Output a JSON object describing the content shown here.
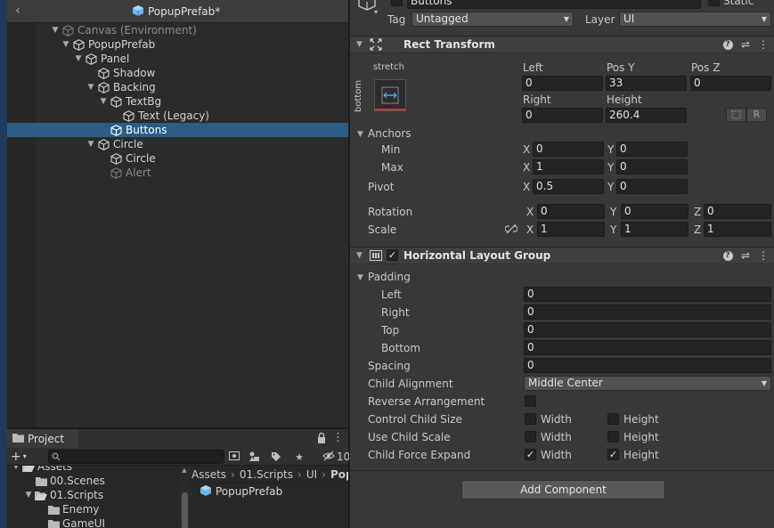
{
  "colors": {
    "selection": "#2c5d87",
    "prefab_cube": "#6fb6e8",
    "inspector_bg": "#383838",
    "hierarchy_bg": "#2b2b2b"
  },
  "hierarchy": {
    "title": "PopupPrefab*",
    "rows": [
      {
        "label": "Canvas (Environment)",
        "expanded": true,
        "state": "dim"
      },
      {
        "label": "PopupPrefab",
        "expanded": true,
        "state": "normal"
      },
      {
        "label": "Panel",
        "expanded": true,
        "state": "normal"
      },
      {
        "label": "Shadow",
        "expanded": null,
        "state": "normal"
      },
      {
        "label": "Backing",
        "expanded": true,
        "state": "normal"
      },
      {
        "label": "TextBg",
        "expanded": true,
        "state": "normal"
      },
      {
        "label": "Text (Legacy)",
        "expanded": null,
        "state": "normal"
      },
      {
        "label": "Buttons",
        "expanded": null,
        "state": "selected"
      },
      {
        "label": "Circle",
        "expanded": true,
        "state": "normal"
      },
      {
        "label": "Circle",
        "expanded": null,
        "state": "normal"
      },
      {
        "label": "Alert",
        "expanded": null,
        "state": "dim"
      }
    ]
  },
  "project": {
    "tab_label": "Project",
    "search_placeholder": "",
    "hidden_count": "10",
    "tree": [
      {
        "label": "Assets",
        "expanded": true
      },
      {
        "label": "00.Scenes",
        "expanded": null
      },
      {
        "label": "01.Scripts",
        "expanded": true
      },
      {
        "label": "Enemy",
        "expanded": null
      },
      {
        "label": "GameUI",
        "expanded": null
      }
    ],
    "breadcrumb": [
      "Assets",
      "01.Scripts",
      "UI",
      "Pop"
    ],
    "files": [
      "PopupPrefab"
    ]
  },
  "inspector": {
    "gameobject_name": "Buttons",
    "static_label": "Static",
    "tag_label": "Tag",
    "tag_value": "Untagged",
    "layer_label": "Layer",
    "layer_value": "UI",
    "rect_transform": {
      "title": "Rect Transform",
      "anchor_preset_h": "stretch",
      "anchor_preset_v": "bottom",
      "left_label": "Left",
      "left": "0",
      "posy_label": "Pos Y",
      "posy": "33",
      "posz_label": "Pos Z",
      "posz": "0",
      "right_label": "Right",
      "right": "0",
      "height_label": "Height",
      "height": "260.4",
      "raw_label": "R",
      "anchors_label": "Anchors",
      "min_label": "Min",
      "min_x": "0",
      "min_y": "0",
      "max_label": "Max",
      "max_x": "1",
      "max_y": "0",
      "pivot_label": "Pivot",
      "pivot_x": "0.5",
      "pivot_y": "0",
      "rotation_label": "Rotation",
      "rot_x": "0",
      "rot_y": "0",
      "rot_z": "0",
      "scale_label": "Scale",
      "scale_x": "1",
      "scale_y": "1",
      "scale_z": "1",
      "x": "X",
      "y": "Y",
      "z": "Z"
    },
    "hlg": {
      "title": "Horizontal Layout Group",
      "enabled": true,
      "padding_label": "Padding",
      "left_label": "Left",
      "left": "0",
      "right_label": "Right",
      "right": "0",
      "top_label": "Top",
      "top": "0",
      "bottom_label": "Bottom",
      "bottom": "0",
      "spacing_label": "Spacing",
      "spacing": "0",
      "child_alignment_label": "Child Alignment",
      "child_alignment": "Middle Center",
      "reverse_label": "Reverse Arrangement",
      "reverse": false,
      "control_size_label": "Control Child Size",
      "use_scale_label": "Use Child Scale",
      "force_expand_label": "Child Force Expand",
      "width_label": "Width",
      "height_label": "Height",
      "control_width": false,
      "control_height": false,
      "scale_width": false,
      "scale_height": false,
      "expand_width": true,
      "expand_height": true
    },
    "add_component": "Add Component"
  }
}
